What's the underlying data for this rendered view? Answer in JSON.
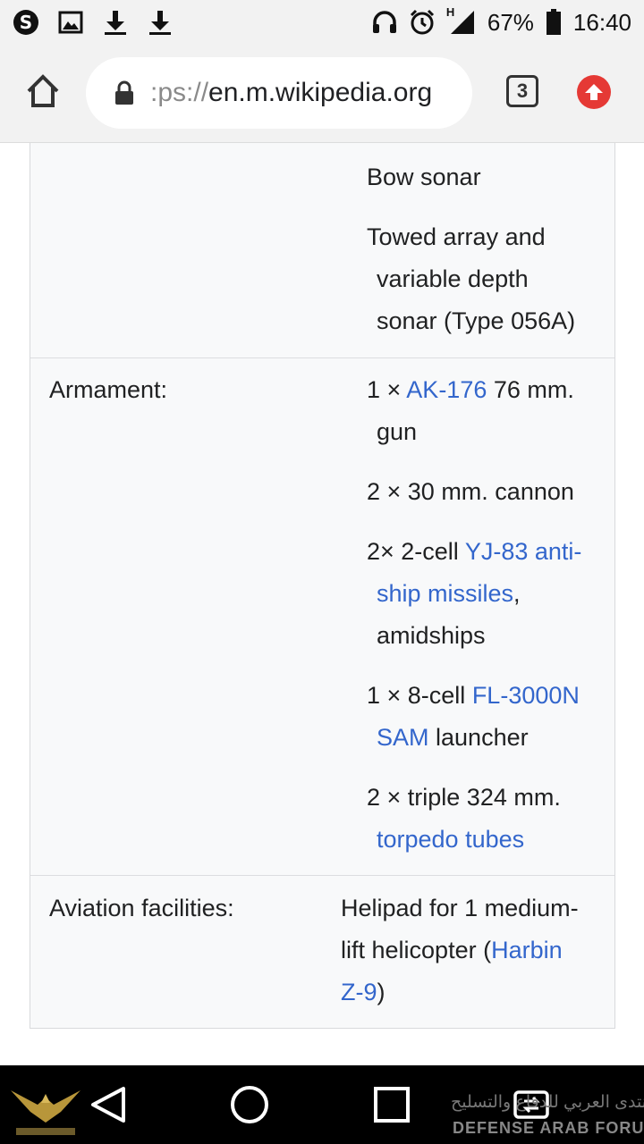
{
  "status_bar": {
    "battery_percent": "67%",
    "time": "16:40",
    "network_type": "H",
    "icons": [
      "s-notification-icon",
      "image-icon",
      "download-icon",
      "download-icon",
      "headset-icon",
      "alarm-icon",
      "signal-icon",
      "battery-icon"
    ]
  },
  "toolbar": {
    "url_prefix": ":ps://",
    "url_host": "en.m.wikipedia.org",
    "tab_count": "3"
  },
  "infobox": {
    "sensors_continued": {
      "items": [
        {
          "lines": [
            [
              {
                "t": "Bow sonar"
              }
            ]
          ]
        },
        {
          "lines": [
            [
              {
                "t": "Towed array and"
              }
            ],
            [
              {
                "t": "variable depth"
              }
            ],
            [
              {
                "t": "sonar (Type 056A)"
              }
            ]
          ]
        }
      ]
    },
    "armament": {
      "label": "Armament:",
      "items": [
        {
          "lines": [
            [
              {
                "t": "1 × "
              },
              {
                "t": "AK-176",
                "link": true
              },
              {
                "t": " 76 mm."
              }
            ],
            [
              {
                "t": "gun"
              }
            ]
          ]
        },
        {
          "lines": [
            [
              {
                "t": "2 × 30 mm. cannon"
              }
            ]
          ]
        },
        {
          "lines": [
            [
              {
                "t": "2× 2-cell "
              },
              {
                "t": "YJ-83 anti-",
                "link": true
              }
            ],
            [
              {
                "t": "ship missiles",
                "link": true
              },
              {
                "t": ","
              }
            ],
            [
              {
                "t": "amidships"
              }
            ]
          ]
        },
        {
          "lines": [
            [
              {
                "t": "1 × 8-cell "
              },
              {
                "t": "FL-3000N",
                "link": true
              }
            ],
            [
              {
                "t": "SAM",
                "link": true
              },
              {
                "t": " launcher"
              }
            ]
          ]
        },
        {
          "lines": [
            [
              {
                "t": "2 × triple 324 mm."
              }
            ],
            [
              {
                "t": "torpedo tubes",
                "link": true
              }
            ]
          ]
        }
      ]
    },
    "aviation": {
      "label": "Aviation facilities:",
      "lines": [
        [
          {
            "t": "Helipad for 1 medium-"
          }
        ],
        [
          {
            "t": "lift helicopter ("
          },
          {
            "t": "Harbin",
            "link": true
          }
        ],
        [
          {
            "t": "Z-9",
            "link": true
          },
          {
            "t": ")"
          }
        ]
      ]
    }
  },
  "watermark": {
    "arabic_text": "المنتدى العربي للدفاع والتسليح",
    "english_text": "DEFENSE ARAB FORUM"
  },
  "colors": {
    "link": "#3366cc",
    "infobox_bg": "#f8f9fa",
    "update_badge": "#e53935"
  }
}
